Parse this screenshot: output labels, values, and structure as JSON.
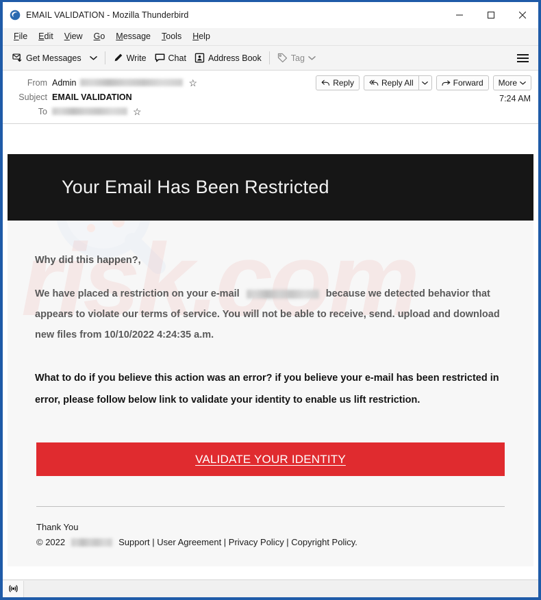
{
  "window": {
    "title": "EMAIL VALIDATION - Mozilla Thunderbird",
    "app_icon": "thunderbird-icon",
    "minimize_label": "Minimize",
    "maximize_label": "Maximize",
    "close_label": "Close",
    "frame_color": "#1f5ba8"
  },
  "menubar": {
    "items": [
      {
        "label": "File",
        "accel": "F"
      },
      {
        "label": "Edit",
        "accel": "E"
      },
      {
        "label": "View",
        "accel": "V"
      },
      {
        "label": "Go",
        "accel": "G"
      },
      {
        "label": "Message",
        "accel": "M"
      },
      {
        "label": "Tools",
        "accel": "T"
      },
      {
        "label": "Help",
        "accel": "H"
      }
    ]
  },
  "toolbar": {
    "get_messages": "Get Messages",
    "write": "Write",
    "chat": "Chat",
    "address_book": "Address Book",
    "tag": "Tag",
    "app_menu": "Application Menu"
  },
  "message_header": {
    "from_label": "From",
    "from_name": "Admin",
    "from_address_redacted": true,
    "subject_label": "Subject",
    "subject": "EMAIL VALIDATION",
    "to_label": "To",
    "to_address_redacted": true,
    "time": "7:24 AM",
    "actions": {
      "reply": "Reply",
      "reply_all": "Reply All",
      "forward": "Forward",
      "more": "More"
    }
  },
  "email": {
    "banner_title": "Your Email Has Been Restricted",
    "banner_bg": "#161616",
    "lead": "Why did this happen?,",
    "paragraph_part1": "We have placed a restriction on your e-mail",
    "paragraph_part2": "because we detected behavior that appears to violate our terms of service. You will not be able to receive, send. upload and download new files from 10/10/2022 4:24:35 a.m.",
    "strong_paragraph": "What to do if you believe this action was an error? if you believe your e-mail has been restricted in error, please follow below link to validate your identity to enable us lift restriction.",
    "cta_label": "VALIDATE YOUR IDENTITY",
    "cta_color": "#e02b2f",
    "footer": {
      "thanks": "Thank You",
      "copyright": "© 2022",
      "brand_redacted": true,
      "links": "Support | User Agreement | Privacy Policy | Copyright Policy."
    },
    "watermark_text": "risk.com"
  },
  "statusbar": {
    "icon": "rss-broadcast-icon",
    "text": ""
  }
}
